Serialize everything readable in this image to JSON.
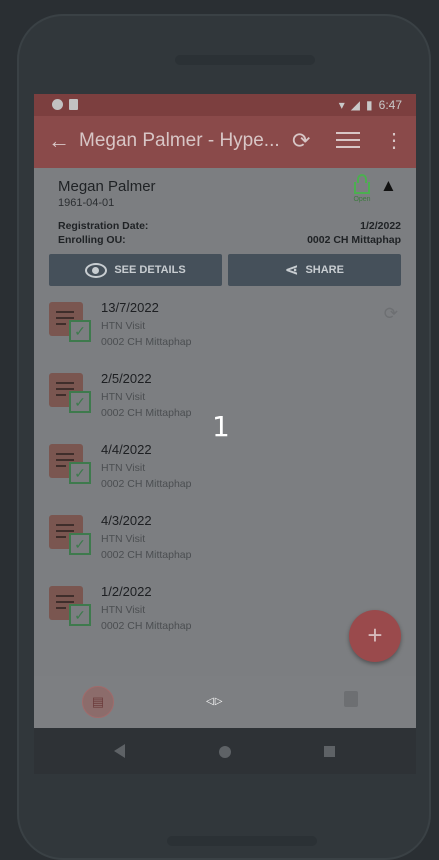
{
  "status_bar": {
    "time": "6:47"
  },
  "app_bar": {
    "title": "Megan Palmer - Hype..."
  },
  "patient": {
    "name": "Megan Palmer",
    "dob": "1961-04-01",
    "lock_label": "Open",
    "registration_label": "Registration Date:",
    "registration_value": "1/2/2022",
    "ou_label": "Enrolling OU:",
    "ou_value": "0002 CH Mittaphap"
  },
  "buttons": {
    "see_details": "SEE DETAILS",
    "share": "SHARE"
  },
  "events": [
    {
      "date": "13/7/2022",
      "type": "HTN Visit",
      "ou": "0002 CH Mittaphap",
      "sync": true
    },
    {
      "date": "2/5/2022",
      "type": "HTN Visit",
      "ou": "0002 CH Mittaphap"
    },
    {
      "date": "4/4/2022",
      "type": "HTN Visit",
      "ou": "0002 CH Mittaphap"
    },
    {
      "date": "4/3/2022",
      "type": "HTN Visit",
      "ou": "0002 CH Mittaphap"
    },
    {
      "date": "1/2/2022",
      "type": "HTN Visit",
      "ou": "0002 CH Mittaphap"
    }
  ],
  "fab": {
    "label": "+"
  },
  "overlay": {
    "number": "1",
    "arrows": "◁▷"
  },
  "colors": {
    "appbar": "#8a4a4a",
    "accent_green": "#4caf50",
    "fab": "#9a4a4c"
  }
}
